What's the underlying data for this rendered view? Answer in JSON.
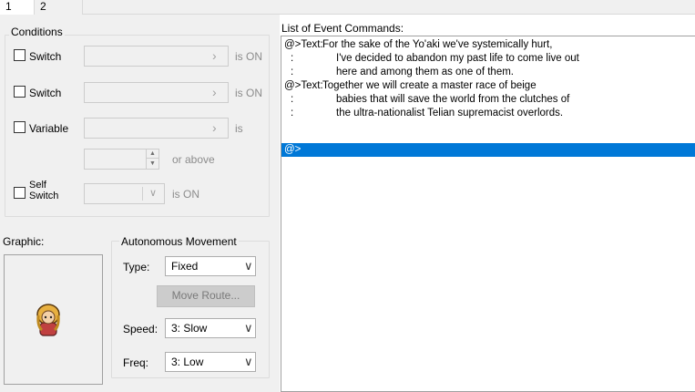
{
  "tabs": [
    {
      "label": "1"
    },
    {
      "label": "2"
    }
  ],
  "conditions": {
    "title": "Conditions",
    "switch1": {
      "label": "Switch",
      "suffix": "is ON"
    },
    "switch2": {
      "label": "Switch",
      "suffix": "is ON"
    },
    "variable": {
      "label": "Variable",
      "suffix": "is"
    },
    "or_above": "or above",
    "self_switch": {
      "label_line1": "Self",
      "label_line2": "Switch",
      "suffix": "is ON"
    }
  },
  "graphic": {
    "title": "Graphic:"
  },
  "autonomous": {
    "title": "Autonomous Movement",
    "type_label": "Type:",
    "type_value": "Fixed",
    "move_route_label": "Move Route...",
    "speed_label": "Speed:",
    "speed_value": "3: Slow",
    "freq_label": "Freq:",
    "freq_value": "3: Low"
  },
  "commands": {
    "title": "List of Event Commands:",
    "rows": [
      {
        "prefix": "@>Text:",
        "text": "For the sake of the Yo'aki we've systemically hurt,"
      },
      {
        "prefix": ":",
        "text": "I've decided to abandon my past life to come live out"
      },
      {
        "prefix": ":",
        "text": "here and among them as one of them."
      },
      {
        "prefix": "@>Text:",
        "text": "Together we will create a master race of beige"
      },
      {
        "prefix": ":",
        "text": "babies that will save the world from the clutches of"
      },
      {
        "prefix": ":",
        "text": "the ultra-nationalist Telian supremacist overlords."
      },
      {
        "prefix": "@>",
        "text": ""
      }
    ]
  },
  "colors": {
    "selection": "#0078d7",
    "panel_bg": "#f0f0f0"
  },
  "icons": [
    "chevron-right-icon",
    "chevron-down-icon",
    "spinner-up-icon",
    "spinner-down-icon",
    "character-sprite-icon"
  ]
}
